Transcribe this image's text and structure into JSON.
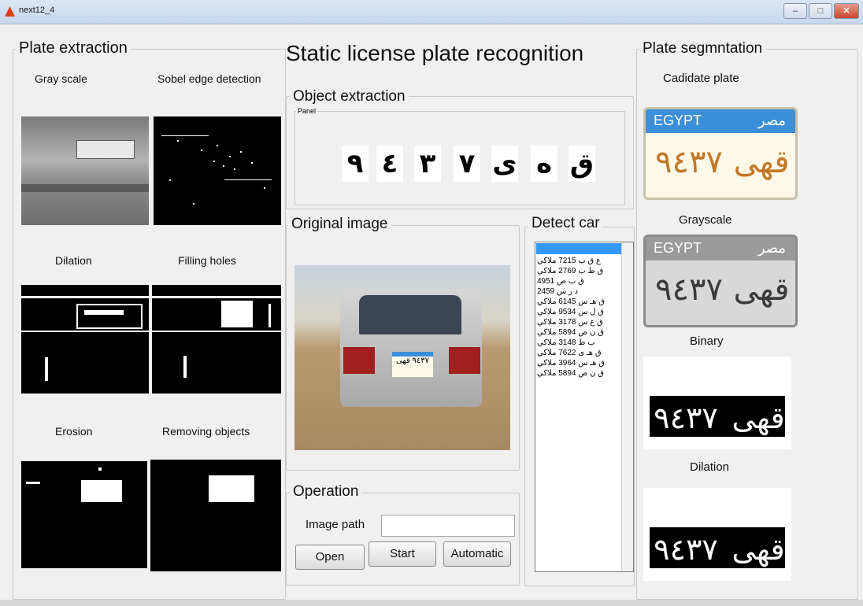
{
  "window": {
    "title": "next12_4",
    "minimize": "–",
    "maximize": "□",
    "close": "✕"
  },
  "main_title": "Static license plate recognition",
  "plate_extraction": {
    "title": "Plate extraction",
    "labels": [
      "Gray scale",
      "Sobel edge detection",
      "Dilation",
      "Filling holes",
      "Erosion",
      "Removing objects"
    ]
  },
  "object_extraction": {
    "title": "Object extraction",
    "panel_label": "Panel",
    "characters": [
      "٩",
      "٤",
      "٣",
      "٧",
      "ى",
      "ه",
      "ق"
    ]
  },
  "original_image": {
    "title": "Original image",
    "plate_text": "٩٤٣٧ قهى"
  },
  "detect_car": {
    "title": "Detect car",
    "items": [
      "ع ق ب 7215 ملاكي",
      "ق ط ب 2769 ملاكي",
      "ق ب ص 4951",
      "د ر س 2459",
      "ق هـ س 6145 ملاكي",
      "ق ل س 9534 ملاكي",
      "ق ع س 3178 ملاكي",
      "ق ن ص 5894 ملاكي",
      "ب ط 3148 ملاكي",
      "ق هـ ى 7622 ملاكي",
      "ق هـ س 3964 ملاكي",
      "ق ن ص 5894 ملاكي"
    ]
  },
  "operation": {
    "title": "Operation",
    "image_path_label": "Image path",
    "image_path_value": "",
    "open": "Open",
    "start": "Start",
    "automatic": "Automatic"
  },
  "plate_segmentation": {
    "title": "Plate segmntation",
    "labels": [
      "Cadidate plate",
      "Grayscale",
      "Binary",
      "Dilation"
    ],
    "plate_country": "EGYPT",
    "plate_country_ar": "مصر",
    "plate_number": "٩٤٣٧",
    "plate_letters": "قهى"
  }
}
